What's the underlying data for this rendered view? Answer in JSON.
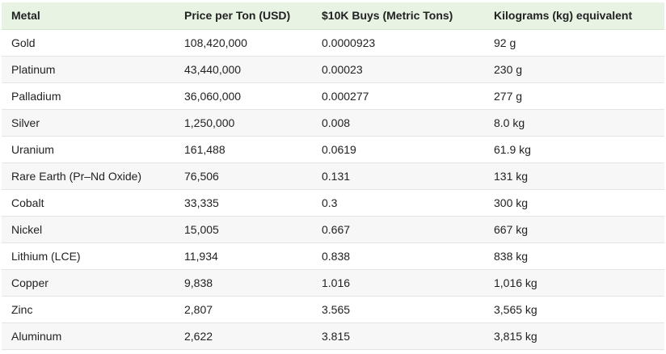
{
  "table": {
    "headers": [
      "Metal",
      "Price per Ton (USD)",
      "$10K Buys (Metric Tons)",
      "Kilograms (kg) equivalent"
    ],
    "rows": [
      [
        "Gold",
        "108,420,000",
        "0.0000923",
        "92 g"
      ],
      [
        "Platinum",
        "43,440,000",
        "0.00023",
        "230 g"
      ],
      [
        "Palladium",
        "36,060,000",
        "0.000277",
        "277 g"
      ],
      [
        "Silver",
        "1,250,000",
        "0.008",
        "8.0 kg"
      ],
      [
        "Uranium",
        "161,488",
        "0.0619",
        "61.9 kg"
      ],
      [
        "Rare Earth (Pr–Nd Oxide)",
        "76,506",
        "0.131",
        "131 kg"
      ],
      [
        "Cobalt",
        "33,335",
        "0.3",
        "300 kg"
      ],
      [
        "Nickel",
        "15,005",
        "0.667",
        "667 kg"
      ],
      [
        "Lithium (LCE)",
        "11,934",
        "0.838",
        "838 kg"
      ],
      [
        "Copper",
        "9,838",
        "1.016",
        "1,016 kg"
      ],
      [
        "Zinc",
        "2,807",
        "3.565",
        "3,565 kg"
      ],
      [
        "Aluminum",
        "2,622",
        "3.815",
        "3,815 kg"
      ]
    ]
  },
  "colors": {
    "header_bg": "#e8f3e4",
    "row_alt_bg": "#f7f7f7",
    "text": "#222222"
  }
}
